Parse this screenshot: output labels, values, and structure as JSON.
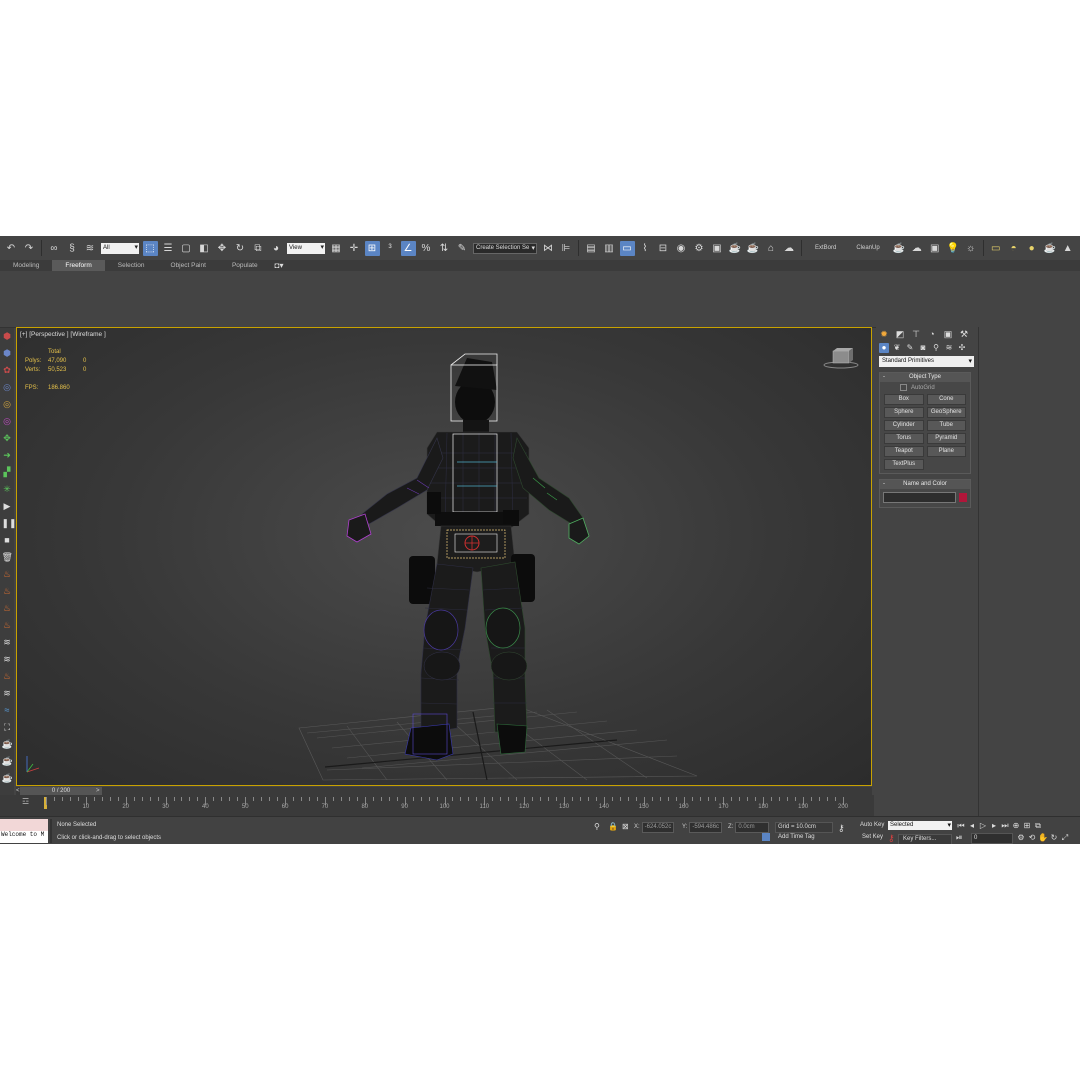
{
  "toolbar": {
    "selection_filter": "All",
    "ref_coord": "View",
    "named_selection": "Create Selection Se",
    "plugin_labels": [
      "ExtBord",
      "CleanUp"
    ]
  },
  "ribbon": {
    "tabs": [
      "Modeling",
      "Freeform",
      "Selection",
      "Object Paint",
      "Populate"
    ],
    "active_tab": "Freeform"
  },
  "viewport": {
    "label": "[+] [Perspective ] [Wireframe ]",
    "stats": {
      "header": "Total",
      "polys_label": "Polys:",
      "polys_total": "47,090",
      "polys_sel": "0",
      "verts_label": "Verts:",
      "verts_total": "50,523",
      "verts_sel": "0",
      "fps_label": "FPS:",
      "fps_value": "186.860"
    }
  },
  "command_panel": {
    "category_dropdown": "Standard Primitives",
    "object_type_title": "Object Type",
    "autogrid_label": "AutoGrid",
    "primitives": [
      "Box",
      "Cone",
      "Sphere",
      "GeoSphere",
      "Cylinder",
      "Tube",
      "Torus",
      "Pyramid",
      "Teapot",
      "Plane",
      "TextPlus"
    ],
    "name_color_title": "Name and Color",
    "object_color": "#b0163a"
  },
  "timeline": {
    "slider_label": "0 / 200",
    "ticks": [
      "10",
      "20",
      "30",
      "40",
      "50",
      "60",
      "70",
      "80",
      "90",
      "100",
      "110",
      "120",
      "130",
      "140",
      "150",
      "160",
      "170",
      "180",
      "190",
      "200"
    ],
    "frame_range_end": 200
  },
  "status": {
    "maxscript_text": "Welcome to M",
    "selection_status": "None Selected",
    "prompt": "Click or click-and-drag to select objects",
    "x_label": "X:",
    "x_value": "-624.052c",
    "y_label": "Y:",
    "y_value": "-594.486c",
    "z_label": "Z:",
    "z_value": "0.0cm",
    "grid": "Grid = 10.0cm",
    "add_time_tag": "Add Time Tag",
    "auto_key": "Auto Key",
    "set_key": "Set Key",
    "key_mode": "Selected",
    "key_filters": "Key Filters...",
    "current_frame": "0"
  },
  "colors": {
    "viewport_border": "#c8a200",
    "stats_text": "#e6c24a",
    "active_blue": "#5b85c4"
  }
}
